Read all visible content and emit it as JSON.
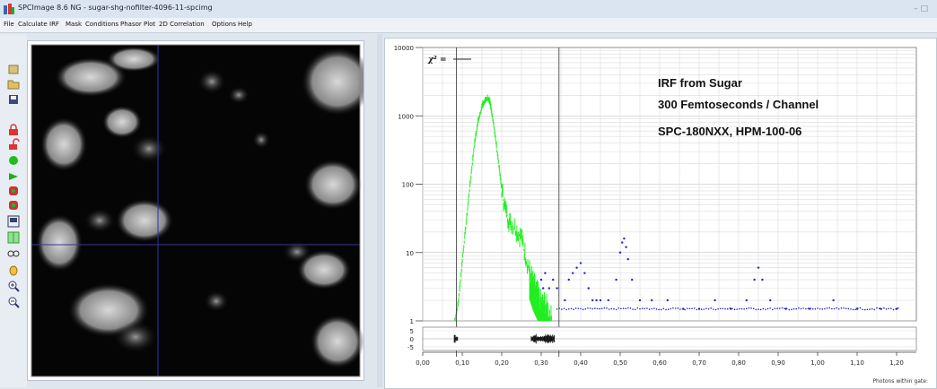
{
  "window": {
    "title": "SPCImage 8.6 NG - sugar-shg-nofilter-4096-11-spcimg",
    "controls": "– □"
  },
  "menu": [
    "File",
    "Calculate",
    "IRF",
    "Mask",
    "Conditions",
    "Phasor Plot",
    "2D Correlation",
    "Options",
    "Help"
  ],
  "toolbar_icons": [
    "open-icon",
    "open-folder-icon",
    "save-icon",
    "lock-red-icon",
    "unlock-icon",
    "green-shape-icon",
    "arrow-green-icon",
    "red-shape-icon",
    "red-shape2-icon",
    "panel-icon",
    "green-grid-icon",
    "glasses-icon",
    "hand-icon",
    "zoom-in-icon",
    "zoom-out-icon"
  ],
  "chi_label": "χ² =",
  "annotations": [
    "IRF from Sugar",
    "300 Femtoseconds / Channel",
    "SPC-180NXX, HPM-100-06"
  ],
  "y_ticks": [
    "10000",
    "1000",
    "100",
    "10",
    "1"
  ],
  "residual_ticks": [
    "5",
    "0",
    "-5"
  ],
  "x_ticks": [
    "0,00",
    "0,10",
    "0,20",
    "0,30",
    "0,40",
    "0,50",
    "0,60",
    "0,70",
    "0,80",
    "0,90",
    "1,00",
    "1,10",
    "1,20"
  ],
  "footer": "Photons within gate:",
  "colors": {
    "fit": "#22ee22",
    "data": "#2222cc",
    "cursor": "#3333aa",
    "annotation": "#111111"
  },
  "chart_data": {
    "type": "scatter",
    "y_scale": "log",
    "ylim": [
      1,
      10000
    ],
    "xlim": [
      0,
      1.25
    ],
    "cursors_x": [
      0.085,
      0.345
    ],
    "series": [
      {
        "kind": "fit-curve",
        "x": [
          0.08,
          0.09,
          0.1,
          0.11,
          0.12,
          0.13,
          0.14,
          0.15,
          0.16,
          0.165,
          0.17,
          0.18,
          0.19,
          0.2,
          0.21,
          0.22,
          0.23,
          0.24,
          0.25,
          0.26,
          0.27,
          0.28,
          0.29,
          0.3,
          0.31,
          0.32,
          0.33
        ],
        "y": [
          1,
          2,
          8,
          30,
          110,
          380,
          900,
          1500,
          1900,
          2000,
          1700,
          800,
          280,
          90,
          45,
          30,
          28,
          22,
          18,
          10,
          6,
          4,
          3,
          2,
          2,
          1.5,
          1
        ]
      },
      {
        "kind": "data-points",
        "x": [
          0.3,
          0.305,
          0.31,
          0.32,
          0.33,
          0.34,
          0.36,
          0.37,
          0.38,
          0.39,
          0.4,
          0.41,
          0.42,
          0.43,
          0.44,
          0.45,
          0.47,
          0.49,
          0.5,
          0.505,
          0.51,
          0.515,
          0.52,
          0.53,
          0.55,
          0.58,
          0.62,
          0.66,
          0.7,
          0.74,
          0.78,
          0.82,
          0.84,
          0.85,
          0.86,
          0.88,
          0.92,
          0.98,
          1.04,
          1.1,
          1.16,
          1.2
        ],
        "y": [
          4,
          3,
          5,
          3,
          4,
          3,
          2,
          4,
          5,
          6,
          7,
          5,
          3,
          2,
          2,
          2,
          2,
          4,
          10,
          14,
          16,
          12,
          8,
          4,
          2,
          2,
          2,
          1.5,
          1.5,
          2,
          1.5,
          2,
          4,
          6,
          4,
          2,
          1.5,
          1.5,
          2,
          1.5,
          1.5,
          1.5
        ]
      }
    ]
  }
}
